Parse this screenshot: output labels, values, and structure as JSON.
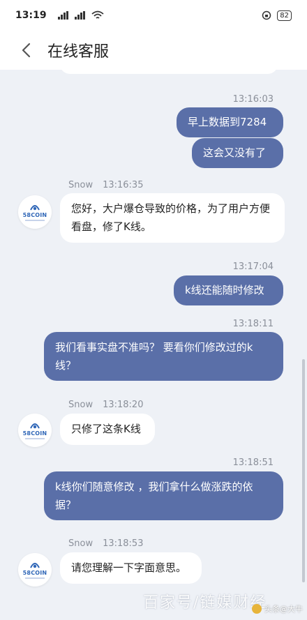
{
  "status_bar": {
    "time": "13:19",
    "signal1": "4G",
    "signal2": "4G",
    "battery": "82"
  },
  "nav": {
    "title": "在线客服"
  },
  "avatar": {
    "logo_text": "58COIN"
  },
  "messages": [
    {
      "direction": "out",
      "time": "13:16:03",
      "lines": [
        "早上数据到7284",
        "这会又没有了"
      ]
    },
    {
      "direction": "in",
      "sender": "Snow",
      "time": "13:16:35",
      "text": "您好，大户爆仓导致的价格，为了用户方便看盘，修了K线。"
    },
    {
      "direction": "out",
      "time": "13:17:04",
      "text": "k线还能随时修改"
    },
    {
      "direction": "out",
      "time": "13:18:11",
      "text": "我们看事实盘不准吗？ 要看你们修改过的k线？"
    },
    {
      "direction": "in",
      "sender": "Snow",
      "time": "13:18:20",
      "text": "只修了这条K线"
    },
    {
      "direction": "out",
      "time": "13:18:51",
      "text": "k线你们随意修改 ，我们拿什么做涨跌的依据？"
    },
    {
      "direction": "in",
      "sender": "Snow",
      "time": "13:18:53",
      "text": "请您理解一下字面意思。"
    }
  ],
  "watermark": {
    "text": "百家号/链媒财经",
    "corner": "头条@大牛"
  },
  "colors": {
    "outgoing_bubble": "#5a6fa8",
    "incoming_bubble": "#ffffff",
    "chat_background": "#eef1f6"
  }
}
